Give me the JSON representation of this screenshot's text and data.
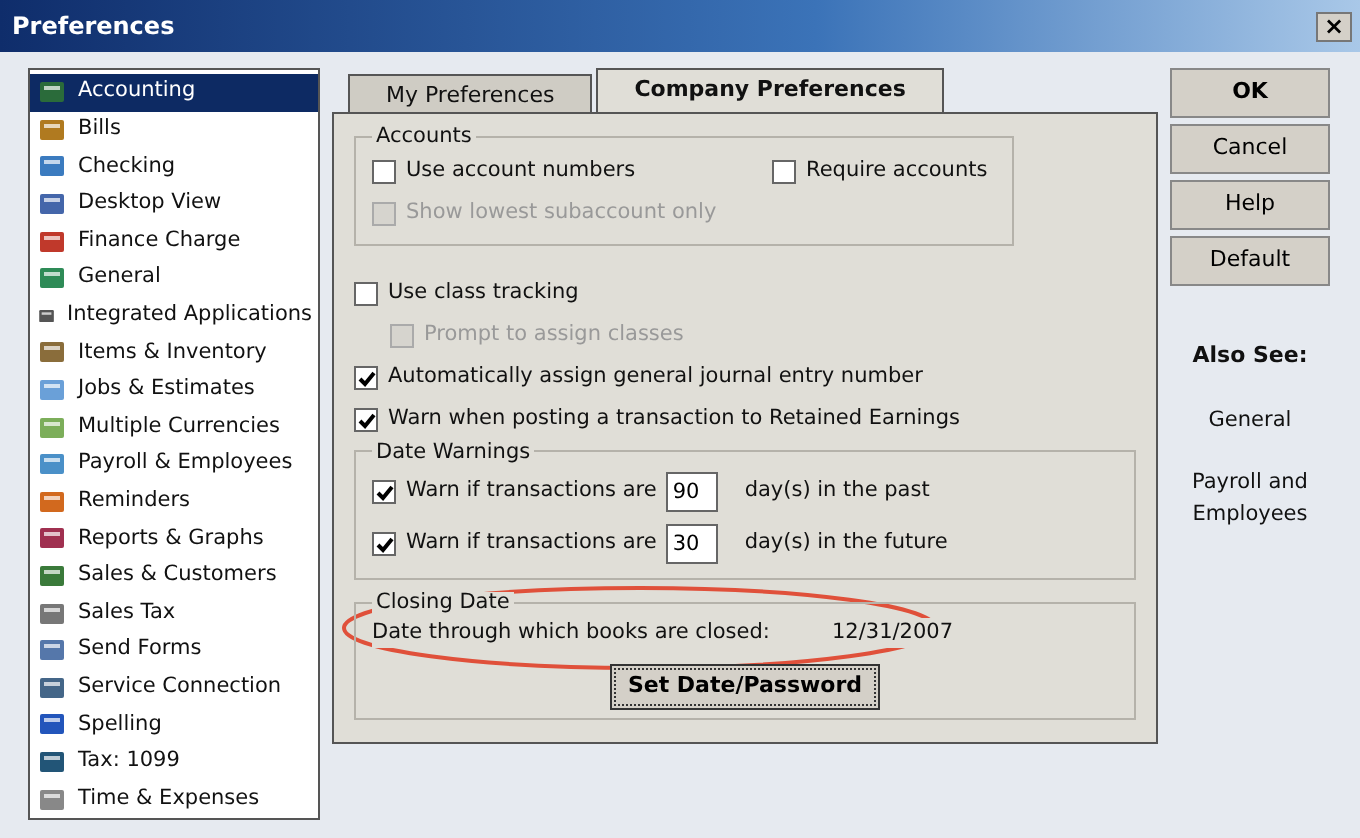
{
  "window": {
    "title": "Preferences",
    "close": "×"
  },
  "sidebar": {
    "items": [
      {
        "label": "Accounting",
        "selected": true
      },
      {
        "label": "Bills",
        "selected": false
      },
      {
        "label": "Checking",
        "selected": false
      },
      {
        "label": "Desktop View",
        "selected": false
      },
      {
        "label": "Finance Charge",
        "selected": false
      },
      {
        "label": "General",
        "selected": false
      },
      {
        "label": "Integrated Applications",
        "selected": false
      },
      {
        "label": "Items & Inventory",
        "selected": false
      },
      {
        "label": "Jobs & Estimates",
        "selected": false
      },
      {
        "label": "Multiple Currencies",
        "selected": false
      },
      {
        "label": "Payroll & Employees",
        "selected": false
      },
      {
        "label": "Reminders",
        "selected": false
      },
      {
        "label": "Reports & Graphs",
        "selected": false
      },
      {
        "label": "Sales & Customers",
        "selected": false
      },
      {
        "label": "Sales Tax",
        "selected": false
      },
      {
        "label": "Send Forms",
        "selected": false
      },
      {
        "label": "Service Connection",
        "selected": false
      },
      {
        "label": "Spelling",
        "selected": false
      },
      {
        "label": "Tax: 1099",
        "selected": false
      },
      {
        "label": "Time & Expenses",
        "selected": false
      }
    ]
  },
  "tabs": [
    {
      "label": "My Preferences",
      "selected": false
    },
    {
      "label": "Company Preferences",
      "selected": true
    }
  ],
  "accounts": {
    "title": "Accounts",
    "options": [
      {
        "label": "Use account numbers",
        "checked": false,
        "disabled": false
      },
      {
        "label": "Require accounts",
        "checked": false,
        "disabled": false
      },
      {
        "label": "Show lowest subaccount only",
        "checked": false,
        "disabled": true
      }
    ]
  },
  "options": [
    {
      "label": "Use class tracking",
      "checked": false,
      "disabled": false,
      "children": [
        {
          "label": "Prompt to assign classes",
          "checked": false,
          "disabled": true
        }
      ]
    },
    {
      "label": "Automatically assign general journal entry number",
      "checked": true,
      "disabled": false
    },
    {
      "label": "Warn when posting a transaction to Retained Earnings",
      "checked": true,
      "disabled": false
    }
  ],
  "date_warnings": {
    "title": "Date Warnings",
    "rows": [
      {
        "label": "Warn if transactions are",
        "checked": true,
        "value": "90",
        "suffix": "day(s) in the past"
      },
      {
        "label": "Warn if transactions are",
        "checked": true,
        "value": "30",
        "suffix": "day(s) in the future"
      }
    ]
  },
  "closing_date": {
    "title": "Closing Date",
    "label": "Date through which books are closed:",
    "date": "12/31/2007",
    "button": "Set Date/Password",
    "highlighted": true
  },
  "buttons": [
    {
      "label": "OK",
      "kind": "bold"
    },
    {
      "label": "Cancel",
      "kind": "plain"
    },
    {
      "label": "Help",
      "kind": "plain"
    },
    {
      "label": "Default",
      "kind": "plain"
    }
  ],
  "also_see": {
    "title": "Also See:",
    "links": [
      "General",
      "Payroll and Employees"
    ]
  }
}
